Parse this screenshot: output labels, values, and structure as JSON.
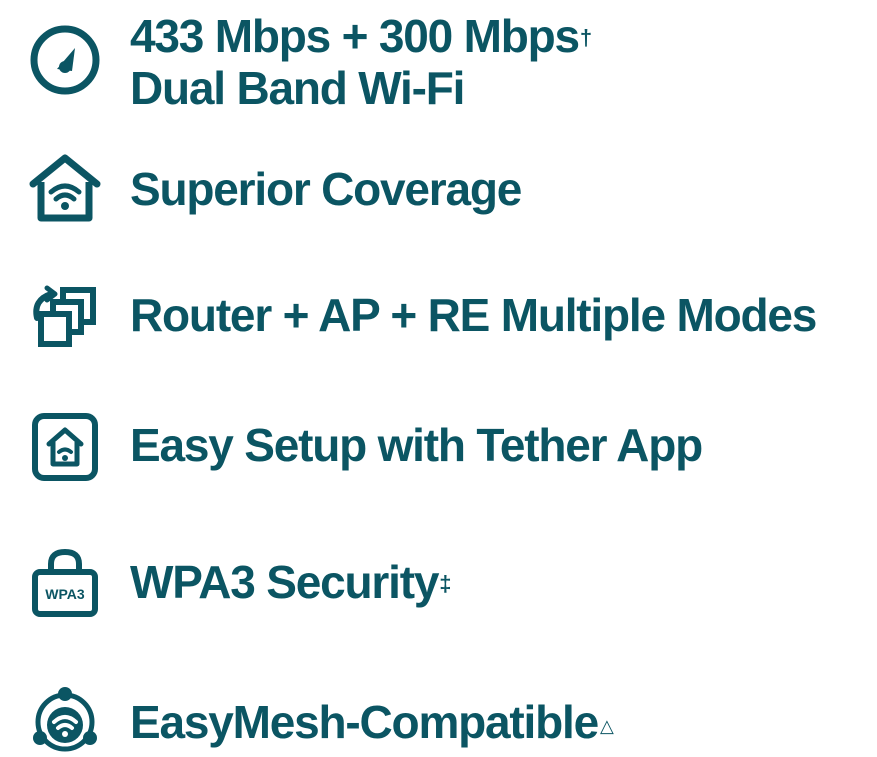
{
  "colors": {
    "brand": "#0b5563"
  },
  "features": [
    {
      "icon": "speedometer-icon",
      "line1": "433 Mbps + 300 Mbps",
      "mark": "†",
      "line2": "Dual Band Wi-Fi"
    },
    {
      "icon": "home-wifi-icon",
      "line1": "Superior Coverage"
    },
    {
      "icon": "multi-mode-icon",
      "line1": "Router + AP + RE Multiple Modes"
    },
    {
      "icon": "tether-app-icon",
      "line1": "Easy Setup with Tether App"
    },
    {
      "icon": "wpa3-lock-icon",
      "line1": "WPA3 Security",
      "mark": "‡",
      "icon_label": "WPA3"
    },
    {
      "icon": "easymesh-icon",
      "line1": "EasyMesh-Compatible",
      "mark": "△"
    }
  ]
}
